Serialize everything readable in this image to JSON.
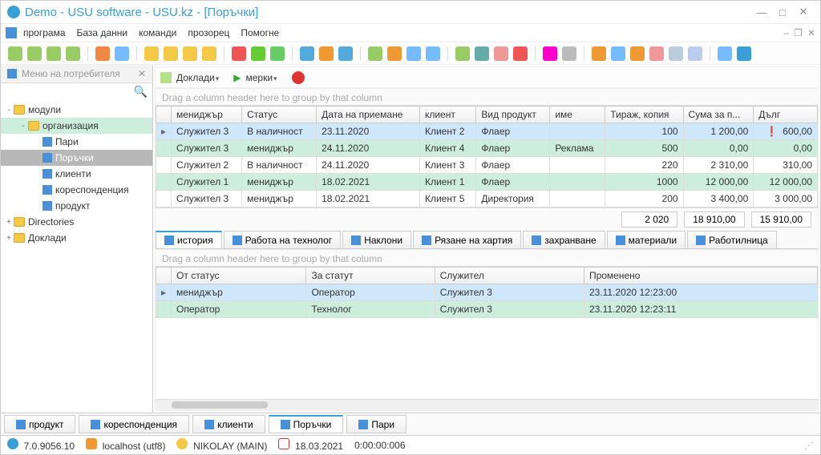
{
  "title": "Demo - USU software - USU.kz - [Поръчки]",
  "menu": {
    "items": [
      "програма",
      "База данни",
      "команди",
      "прозорец",
      "Помогне"
    ]
  },
  "sidebar": {
    "header": "Меню на потребителя",
    "items": [
      {
        "label": "модули",
        "depth": 0,
        "exp": "-",
        "kind": "folder"
      },
      {
        "label": "организация",
        "depth": 1,
        "exp": "-",
        "kind": "folder",
        "cls": "org"
      },
      {
        "label": "Пари",
        "depth": 2,
        "kind": "node"
      },
      {
        "label": "Поръчки",
        "depth": 2,
        "kind": "node",
        "cls": "selitem"
      },
      {
        "label": "клиенти",
        "depth": 2,
        "kind": "node"
      },
      {
        "label": "кореспонденция",
        "depth": 2,
        "kind": "node"
      },
      {
        "label": "продукт",
        "depth": 2,
        "kind": "node"
      },
      {
        "label": "Directories",
        "depth": 0,
        "exp": "+",
        "kind": "folder"
      },
      {
        "label": "Доклади",
        "depth": 0,
        "exp": "+",
        "kind": "folder"
      }
    ]
  },
  "mainbar": {
    "reports": "Доклади",
    "actions": "мерки"
  },
  "grouphint": "Drag a column header here to group by that column",
  "grid": {
    "cols": [
      "мениджър",
      "Статус",
      "Дата на приемане",
      "клиент",
      "Вид продукт",
      "име",
      "Тираж, копия",
      "Сума за п...",
      "Дълг"
    ],
    "rows": [
      {
        "sel": true,
        "c": [
          "Служител 3",
          "В наличност",
          "23.11.2020",
          "Клиент 2",
          "Флаер",
          "",
          "100",
          "1 200,00",
          "600,00"
        ],
        "warn": true
      },
      {
        "alt": true,
        "c": [
          "Служител 3",
          "мениджър",
          "24.11.2020",
          "Клиент 4",
          "Флаер",
          "Реклама",
          "500",
          "0,00",
          "0,00"
        ]
      },
      {
        "c": [
          "Служител 2",
          "В наличност",
          "24.11.2020",
          "Клиент 3",
          "Флаер",
          "",
          "220",
          "2 310,00",
          "310,00"
        ]
      },
      {
        "alt": true,
        "c": [
          "Служител 1",
          "мениджър",
          "18.02.2021",
          "Клиент 1",
          "Флаер",
          "",
          "1000",
          "12 000,00",
          "12 000,00"
        ]
      },
      {
        "c": [
          "Служител 3",
          "мениджър",
          "18.02.2021",
          "Клиент 5",
          "Директория",
          "",
          "200",
          "3 400,00",
          "3 000,00"
        ]
      }
    ],
    "sum": [
      "2 020",
      "18 910,00",
      "15 910,00"
    ]
  },
  "detailtabs": [
    "история",
    "Работа на технолог",
    "Наклони",
    "Рязане на хартия",
    "захранване",
    "материали",
    "Работилница"
  ],
  "detail": {
    "cols": [
      "От статус",
      "За статут",
      "Служител",
      "Променено"
    ],
    "rows": [
      {
        "sel": true,
        "c": [
          "мениджър",
          "Оператор",
          "Служител 3",
          "23.11.2020 12:23:00"
        ]
      },
      {
        "alt": true,
        "c": [
          "Оператор",
          "Технолог",
          "Служител 3",
          "23.11.2020 12:23:11"
        ]
      }
    ]
  },
  "bottomtabs": [
    "продукт",
    "кореспонденция",
    "клиенти",
    "Поръчки",
    "Пари"
  ],
  "status": {
    "ver": "7.0.9056.10",
    "host": "localhost (utf8)",
    "user": "NIKOLAY (MAIN)",
    "date": "18.03.2021",
    "time": "0:00:00:006"
  },
  "tbcolors": [
    "#9c6",
    "#9c6",
    "#9c6",
    "#9c6",
    "#e84",
    "#7bf",
    "#f5c948",
    "#f5c948",
    "#f5c948",
    "#f5c948",
    "#e55",
    "#6c3",
    "#6c6",
    "#5ad",
    "#e93",
    "#5ad",
    "#9c6",
    "#e93",
    "#7bf",
    "#7bf",
    "#9c6",
    "#6aa",
    "#e99",
    "#e55",
    "#f0c",
    "#bbb",
    "#e93",
    "#7bf",
    "#e93",
    "#e99",
    "#bcd",
    "#bce",
    "#7bf",
    "#3b9fd6"
  ]
}
